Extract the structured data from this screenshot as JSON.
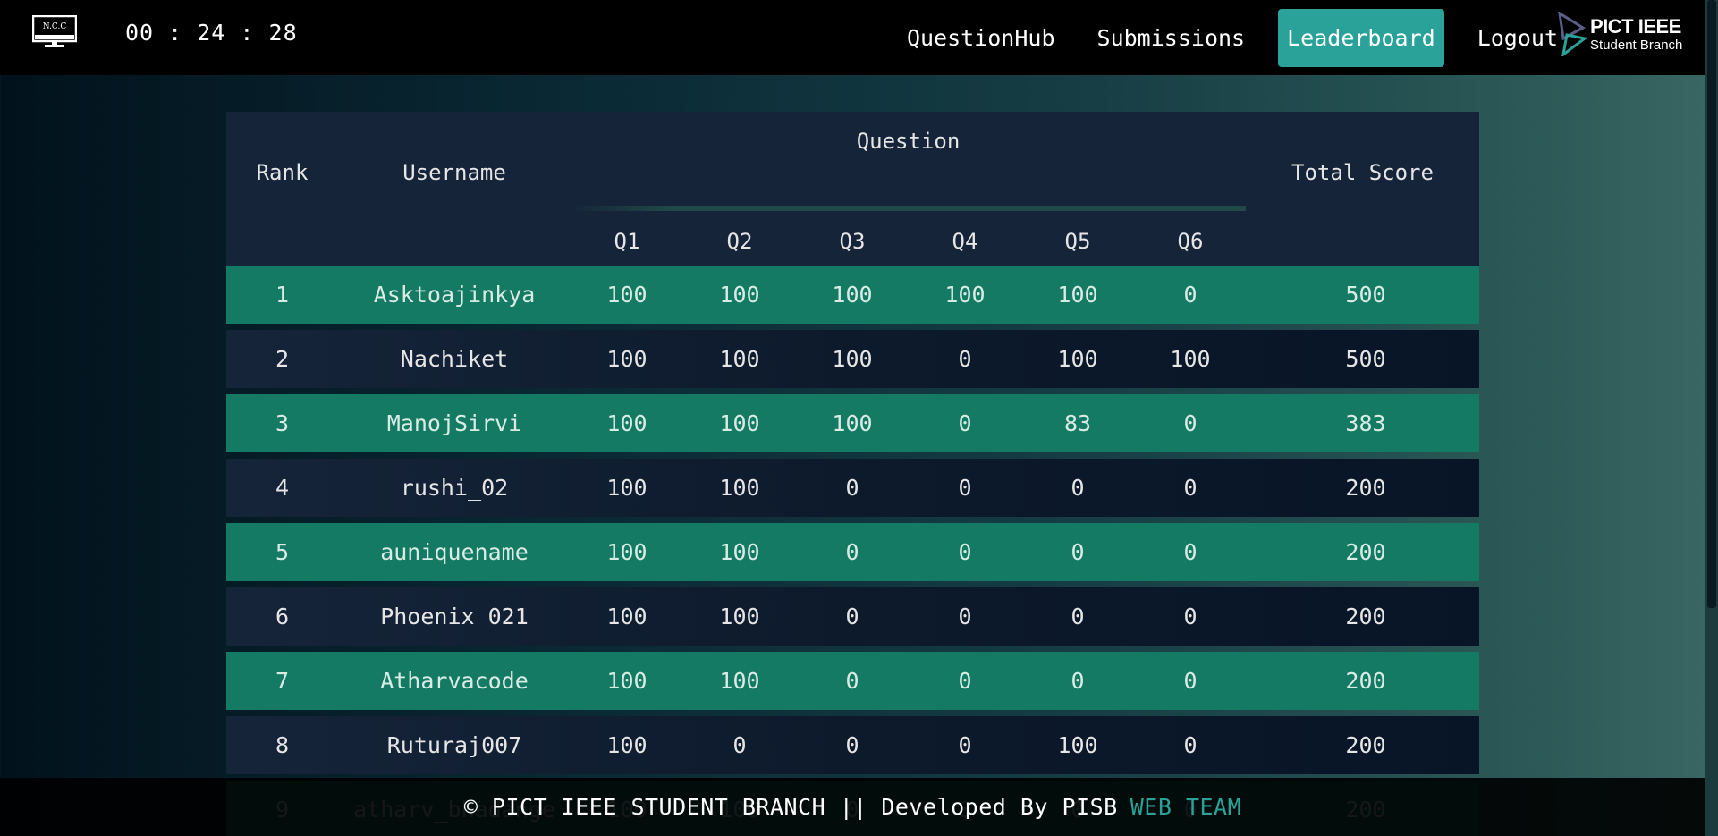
{
  "header": {
    "timer": "00 : 24 : 28",
    "nav": [
      {
        "label": "QuestionHub"
      },
      {
        "label": "Submissions"
      },
      {
        "label": "Leaderboard",
        "active": true
      },
      {
        "label": "Logout"
      }
    ],
    "ncc_logo_text": "N.C.C",
    "brand_title": "PICT IEEE",
    "brand_subtitle": "Student Branch"
  },
  "leaderboard": {
    "headers": {
      "rank": "Rank",
      "username": "Username",
      "question": "Question",
      "total": "Total Score",
      "questions": [
        "Q1",
        "Q2",
        "Q3",
        "Q4",
        "Q5",
        "Q6"
      ]
    },
    "rows": [
      {
        "rank": "1",
        "username": "Asktoajinkya",
        "scores": [
          "100",
          "100",
          "100",
          "100",
          "100",
          "0"
        ],
        "total": "500"
      },
      {
        "rank": "2",
        "username": "Nachiket",
        "scores": [
          "100",
          "100",
          "100",
          "0",
          "100",
          "100"
        ],
        "total": "500"
      },
      {
        "rank": "3",
        "username": "ManojSirvi",
        "scores": [
          "100",
          "100",
          "100",
          "0",
          "83",
          "0"
        ],
        "total": "383"
      },
      {
        "rank": "4",
        "username": "rushi_02",
        "scores": [
          "100",
          "100",
          "0",
          "0",
          "0",
          "0"
        ],
        "total": "200"
      },
      {
        "rank": "5",
        "username": "auniquename",
        "scores": [
          "100",
          "100",
          "0",
          "0",
          "0",
          "0"
        ],
        "total": "200"
      },
      {
        "rank": "6",
        "username": "Phoenix_021",
        "scores": [
          "100",
          "100",
          "0",
          "0",
          "0",
          "0"
        ],
        "total": "200"
      },
      {
        "rank": "7",
        "username": "Atharvacode",
        "scores": [
          "100",
          "100",
          "0",
          "0",
          "0",
          "0"
        ],
        "total": "200"
      },
      {
        "rank": "8",
        "username": "Ruturaj007",
        "scores": [
          "100",
          "0",
          "0",
          "0",
          "100",
          "0"
        ],
        "total": "200"
      },
      {
        "rank": "9",
        "username": "atharv_bhadange",
        "scores": [
          "100",
          "100",
          "0",
          "0",
          "0",
          "0"
        ],
        "total": "200"
      }
    ]
  },
  "footer": {
    "text": "© PICT IEEE STUDENT BRANCH || Developed By PISB",
    "accent": "WEB TEAM"
  },
  "colors": {
    "accent": "#2aa199",
    "row_green": "#157a63",
    "row_dark": "#0d1a2c",
    "header_bg": "#16243a"
  }
}
